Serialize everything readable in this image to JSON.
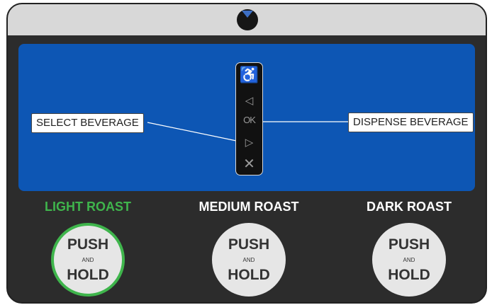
{
  "icons": {
    "top_indicator": "chevron-down-icon",
    "accessibility": "wheelchair-icon",
    "left": "triangle-left-icon",
    "ok": "ok-icon",
    "right": "triangle-right-icon",
    "cancel": "x-icon"
  },
  "keypad": {
    "accessibility_glyph": "♿",
    "left_glyph": "◁",
    "ok_label": "OK",
    "right_glyph": "▷",
    "cancel_glyph": "✕"
  },
  "screen": {
    "callout_left": "SELECT BEVERAGE",
    "callout_right": "DISPENSE BEVERAGE"
  },
  "roasts": [
    {
      "label": "LIGHT ROAST",
      "selected": true,
      "push": "PUSH",
      "and": "AND",
      "hold": "HOLD"
    },
    {
      "label": "MEDIUM ROAST",
      "selected": false,
      "push": "PUSH",
      "and": "AND",
      "hold": "HOLD"
    },
    {
      "label": "DARK ROAST",
      "selected": false,
      "push": "PUSH",
      "and": "AND",
      "hold": "HOLD"
    }
  ],
  "colors": {
    "screen_blue": "#0d56b4",
    "panel_dark": "#2c2c2c",
    "selected_green": "#3fb54c",
    "top_bar": "#d8d8d8"
  }
}
